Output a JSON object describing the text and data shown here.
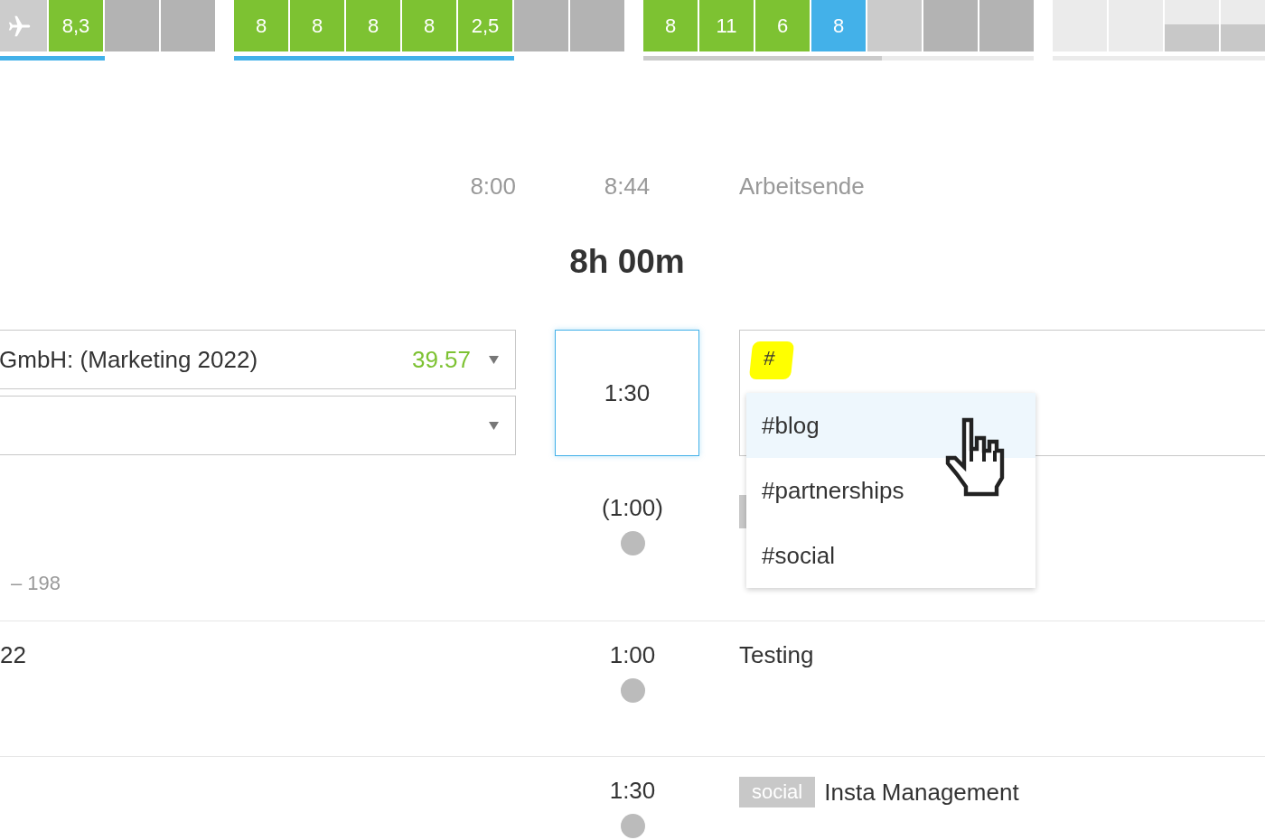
{
  "week_strip": [
    {
      "complete": true,
      "days": [
        {
          "kind": "absence"
        },
        {
          "kind": "worked",
          "value": "8,3"
        },
        {
          "kind": "empty"
        },
        {
          "kind": "empty"
        }
      ]
    },
    {
      "complete": true,
      "days": [
        {
          "kind": "worked",
          "value": "8"
        },
        {
          "kind": "worked",
          "value": "8"
        },
        {
          "kind": "worked",
          "value": "8"
        },
        {
          "kind": "worked",
          "value": "8"
        },
        {
          "kind": "worked",
          "value": "2,5"
        },
        {
          "kind": "empty"
        },
        {
          "kind": "empty"
        }
      ]
    },
    {
      "complete": false,
      "level": 0.61,
      "days": [
        {
          "kind": "worked",
          "value": "8"
        },
        {
          "kind": "worked",
          "value": "11"
        },
        {
          "kind": "worked",
          "value": "6"
        },
        {
          "kind": "today",
          "value": "8"
        },
        {
          "kind": "weekend"
        },
        {
          "kind": "empty"
        },
        {
          "kind": "empty"
        }
      ]
    },
    {
      "days": [
        {
          "kind": "future"
        },
        {
          "kind": "future"
        },
        {
          "kind": "partial"
        },
        {
          "kind": "partial"
        }
      ]
    }
  ],
  "summary": {
    "start": "8:00",
    "now": "8:44",
    "end": "Arbeitsende",
    "total": "8h 00m"
  },
  "editor": {
    "project": "GmbH: (Marketing 2022)",
    "budget": "39.57",
    "duration": "1:30",
    "note": "#",
    "suggestions": [
      {
        "label": "#blog",
        "selected": true
      },
      {
        "label": "#partnerships",
        "selected": false
      },
      {
        "label": "#social",
        "selected": false
      }
    ],
    "planned": "(1:00)",
    "meta": "– 198"
  },
  "entries": [
    {
      "client": "22",
      "duration": "1:00",
      "text": "Testing"
    },
    {
      "duration": "1:30",
      "tags": [
        "social"
      ],
      "text": "Insta Management"
    }
  ]
}
